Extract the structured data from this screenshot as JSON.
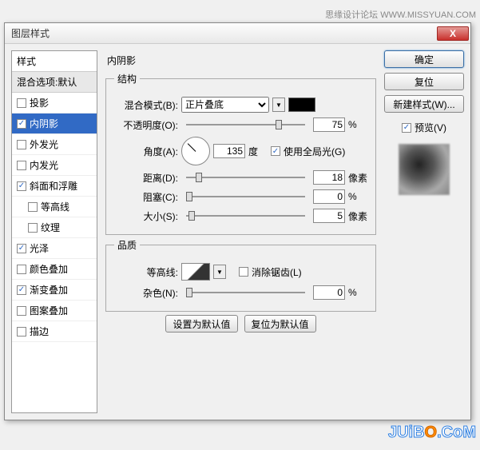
{
  "watermark_top": "思缘设计论坛  WWW.MISSYUAN.COM",
  "dialog": {
    "title": "图层样式",
    "close": "X"
  },
  "styles": {
    "header": "样式",
    "blend_defaults": "混合选项:默认",
    "items": [
      {
        "label": "投影",
        "checked": false,
        "indent": false
      },
      {
        "label": "内阴影",
        "checked": true,
        "indent": false,
        "selected": true
      },
      {
        "label": "外发光",
        "checked": false,
        "indent": false
      },
      {
        "label": "内发光",
        "checked": false,
        "indent": false
      },
      {
        "label": "斜面和浮雕",
        "checked": true,
        "indent": false
      },
      {
        "label": "等高线",
        "checked": false,
        "indent": true
      },
      {
        "label": "纹理",
        "checked": false,
        "indent": true
      },
      {
        "label": "光泽",
        "checked": true,
        "indent": false
      },
      {
        "label": "颜色叠加",
        "checked": false,
        "indent": false
      },
      {
        "label": "渐变叠加",
        "checked": true,
        "indent": false
      },
      {
        "label": "图案叠加",
        "checked": false,
        "indent": false
      },
      {
        "label": "描边",
        "checked": false,
        "indent": false
      }
    ]
  },
  "main": {
    "title": "内阴影",
    "structure": {
      "legend": "结构",
      "blend_mode_label": "混合模式(B):",
      "blend_mode_value": "正片叠底",
      "opacity_label": "不透明度(O):",
      "opacity_value": "75",
      "opacity_unit": "%",
      "angle_label": "角度(A):",
      "angle_value": "135",
      "angle_unit": "度",
      "global_light_label": "使用全局光(G)",
      "distance_label": "距离(D):",
      "distance_value": "18",
      "distance_unit": "像素",
      "choke_label": "阻塞(C):",
      "choke_value": "0",
      "choke_unit": "%",
      "size_label": "大小(S):",
      "size_value": "5",
      "size_unit": "像素"
    },
    "quality": {
      "legend": "品质",
      "contour_label": "等高线:",
      "antialias_label": "消除锯齿(L)",
      "noise_label": "杂色(N):",
      "noise_value": "0",
      "noise_unit": "%"
    },
    "defaults_btn": "设置为默认值",
    "reset_btn": "复位为默认值"
  },
  "right": {
    "ok": "确定",
    "reset": "复位",
    "new_style": "新建样式(W)...",
    "preview_label": "预览(V)"
  },
  "watermark_bottom": "JUiBO.CoM"
}
